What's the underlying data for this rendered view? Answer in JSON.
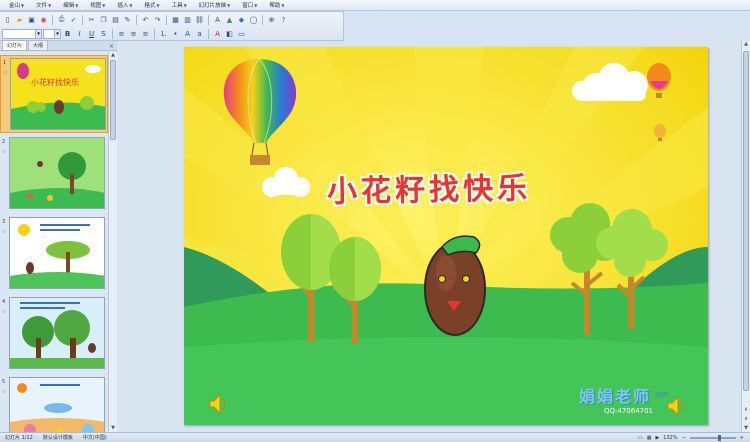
{
  "menu": {
    "items": [
      "文件",
      "编辑",
      "视图",
      "插入",
      "格式",
      "工具",
      "幻灯片放映",
      "窗口",
      "帮助"
    ],
    "app_menu": "金山"
  },
  "toolbar": {
    "font_name": "",
    "font_size": "",
    "zoom": "132%"
  },
  "left_panel": {
    "tabs": [
      "幻灯片",
      "大纲"
    ],
    "close": "×",
    "slide_numbers": [
      "1",
      "2",
      "3",
      "4",
      "5"
    ]
  },
  "slide": {
    "title": "小花籽找快乐",
    "watermark_name": "娟娟老师",
    "watermark_suffix": "制图",
    "watermark_qq": "QQ:47064701"
  },
  "status": {
    "slide_info": "幻灯片 1/12",
    "template": "默认设计模板",
    "language": "中文(中国)",
    "zoom": "132%"
  },
  "colors": {
    "slide_bg": "#f6e21a",
    "grass": "#3dbb4e",
    "title_red": "#e8342a",
    "selection": "#f7c97a"
  }
}
